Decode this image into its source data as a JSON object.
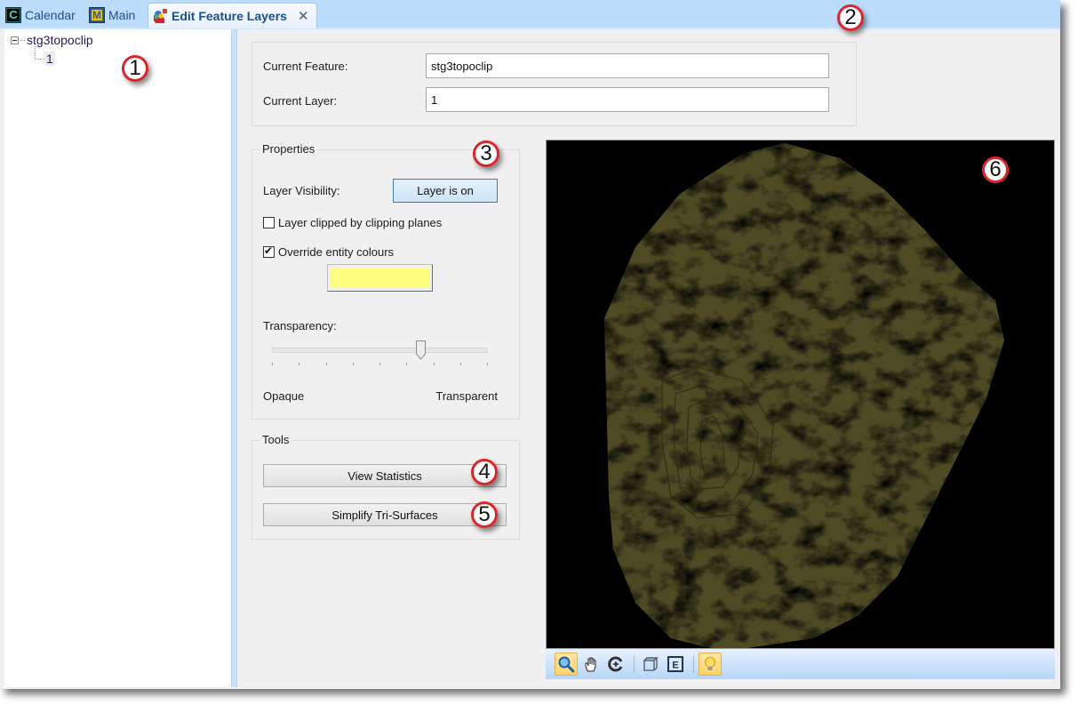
{
  "tabs": [
    {
      "label": "Calendar",
      "icon": "calendar-icon",
      "active": false
    },
    {
      "label": "Main",
      "icon": "main-icon",
      "active": false
    },
    {
      "label": "Edit Feature Layers",
      "icon": "edit-feature-layers-icon",
      "active": true,
      "closable": true
    }
  ],
  "tab_close_glyph": "✕",
  "tree": {
    "root": {
      "label": "stg3topoclip",
      "expanded": true,
      "expander_glyph": "−"
    },
    "children": [
      {
        "label": "1",
        "selected": true
      }
    ]
  },
  "current": {
    "feature_label": "Current Feature:",
    "feature_value": "stg3topoclip",
    "layer_label": "Current Layer:",
    "layer_value": "1"
  },
  "properties": {
    "title": "Properties",
    "visibility_label": "Layer Visibility:",
    "visibility_button": "Layer is on",
    "clipped_label": "Layer clipped by clipping planes",
    "clipped_checked": false,
    "override_label": "Override entity colours",
    "override_checked": true,
    "override_color": "#ffff80",
    "transparency_label": "Transparency:",
    "transparency_value": 0.69,
    "transparency_ticks": 9,
    "opaque_label": "Opaque",
    "transparent_label": "Transparent"
  },
  "tools": {
    "title": "Tools",
    "view_statistics": "View Statistics",
    "simplify": "Simplify Tri-Surfaces"
  },
  "viewport": {
    "background": "#000000",
    "surface_color": "#4d4a24"
  },
  "view_toolbar": [
    {
      "name": "zoom-tool",
      "icon": "magnifier-icon",
      "active": true
    },
    {
      "name": "pan-tool",
      "icon": "hand-icon",
      "active": false
    },
    {
      "name": "rotate-tool",
      "icon": "rotate-icon",
      "active": false
    },
    {
      "separator": true
    },
    {
      "name": "view-cube",
      "icon": "cube-icon",
      "active": false
    },
    {
      "name": "zoom-extents",
      "icon": "zoom-extents-icon",
      "active": false
    },
    {
      "separator": true
    },
    {
      "name": "lighting",
      "icon": "lightbulb-icon",
      "active": true
    }
  ],
  "callouts": [
    "1",
    "2",
    "3",
    "4",
    "5",
    "6"
  ]
}
